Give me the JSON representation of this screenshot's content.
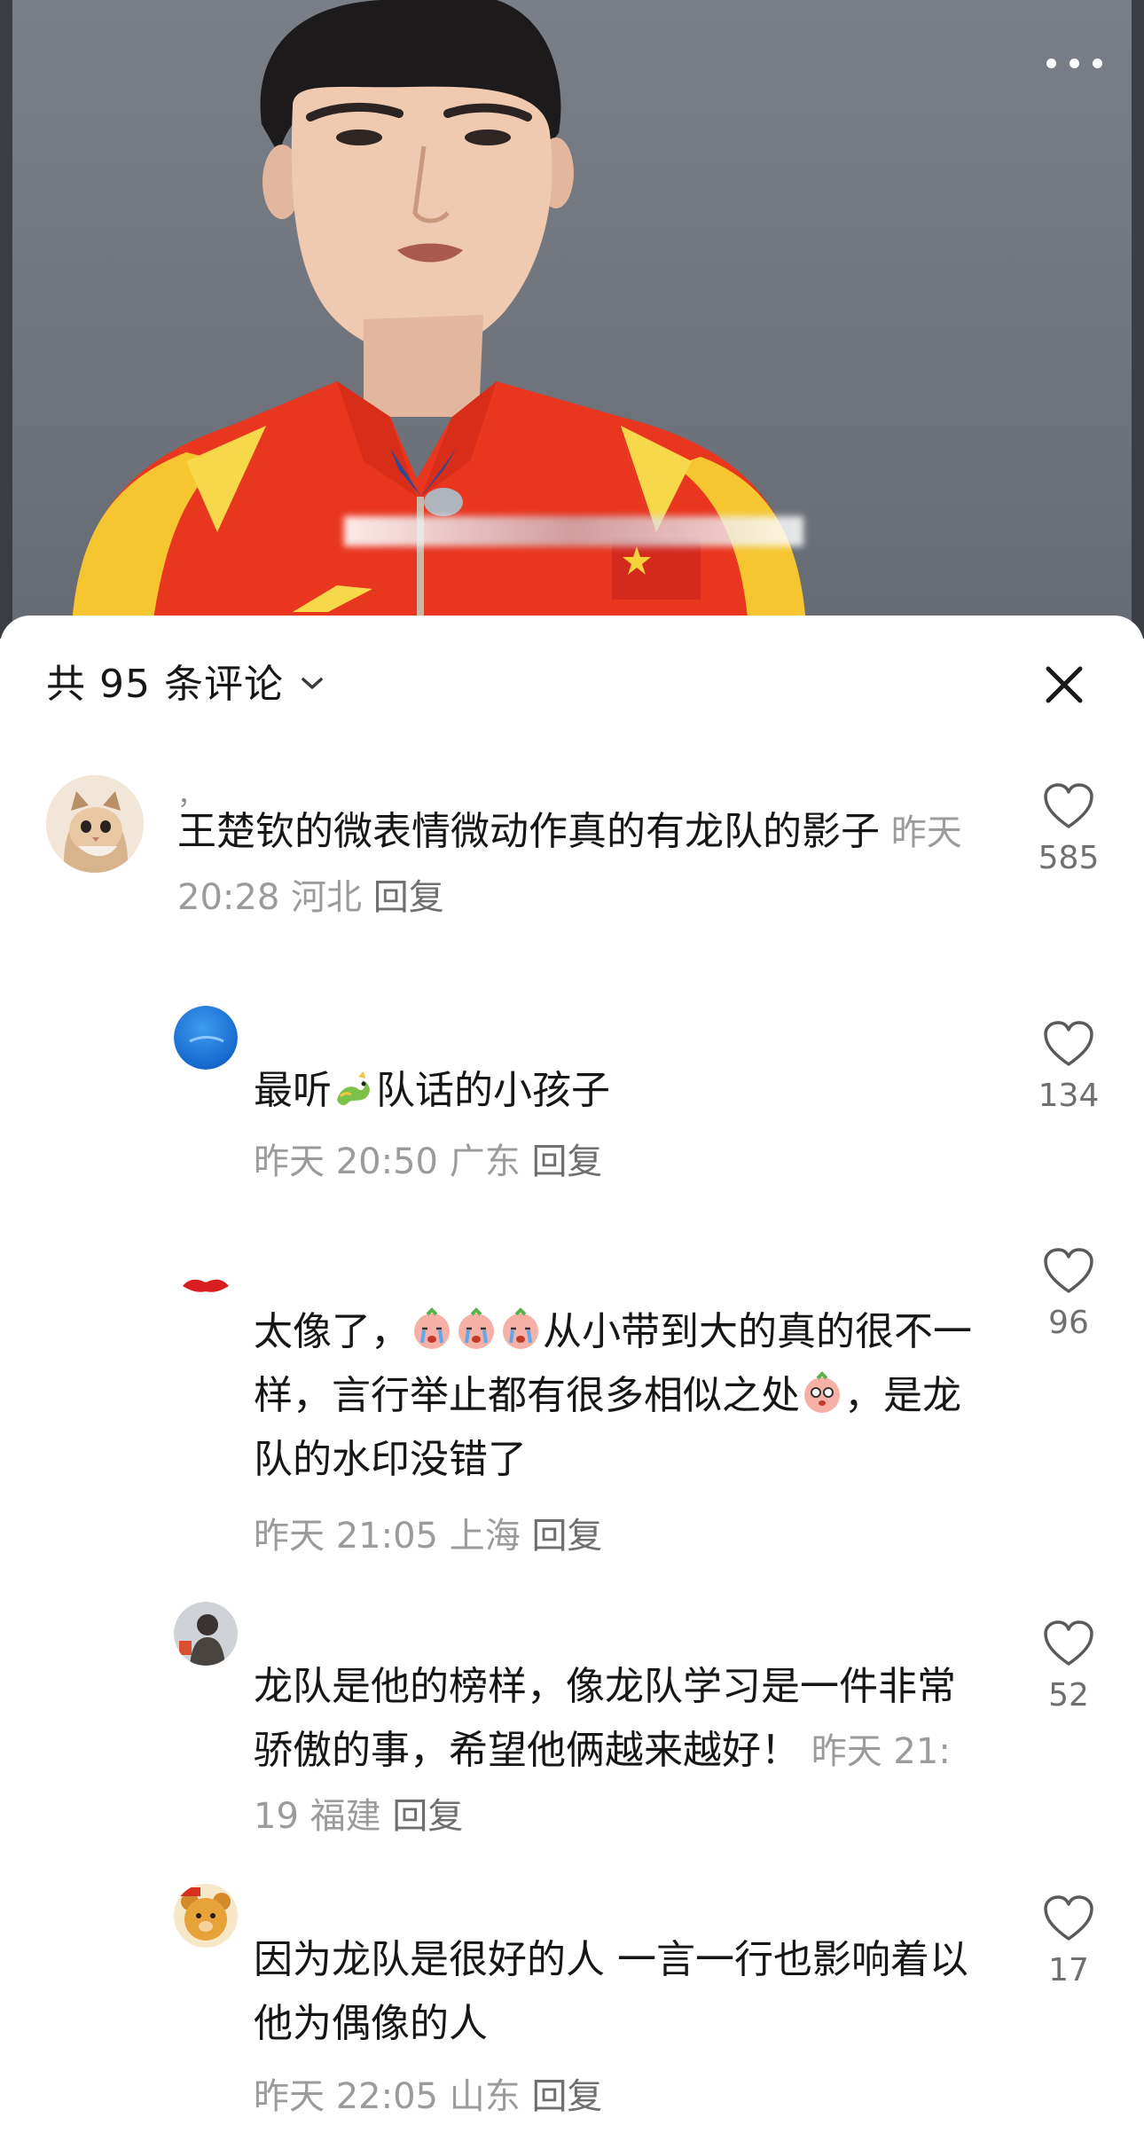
{
  "video": {
    "more_icon": "more-dots-icon",
    "colors": {
      "background": "#70747c",
      "jacket": "#e8361f",
      "accent": "#f7d23a"
    }
  },
  "comments_panel": {
    "title": "共 95 条评论",
    "caret_icon": "chevron-down-icon",
    "close_icon": "close-icon",
    "comments": [
      {
        "username": "，",
        "text": "王楚钦的微表情微动作真的有龙队的影子",
        "time": "昨天 20:28",
        "location": "河北",
        "reply": "回复",
        "likes": "585",
        "avatar": "cat-avatar"
      },
      {
        "username": "",
        "text_before": "最听",
        "emoji": "dragon-emoji",
        "text_after": "队话的小孩子",
        "time": "昨天 20:50",
        "location": "广东",
        "reply": "回复",
        "likes": "134",
        "avatar": "blue-circle-avatar"
      },
      {
        "username": "",
        "text_a": "太像了，",
        "emoji_a": "crying-emoji",
        "text_b": "从小带到大的真的很不一样，言行举止都有很多相似之处",
        "emoji_b": "teary-emoji",
        "text_c": "，是龙队的水印没错了",
        "time": "昨天 21:05",
        "location": "上海",
        "reply": "回复",
        "likes": "96",
        "avatar": "red-lips-avatar"
      },
      {
        "username": "",
        "text": "龙队是他的榜样，像龙队学习是一件非常骄傲的事，希望他俩越来越好！",
        "time": "昨天 21:19",
        "location": "福建",
        "reply": "回复",
        "likes": "52",
        "avatar": "photo-avatar"
      },
      {
        "username": "",
        "text": "因为龙队是很好的人 一言一行也影响着以他为偶像的人",
        "time": "昨天 22:05",
        "location": "山东",
        "reply": "回复",
        "likes": "17",
        "avatar": "bear-avatar"
      }
    ]
  }
}
